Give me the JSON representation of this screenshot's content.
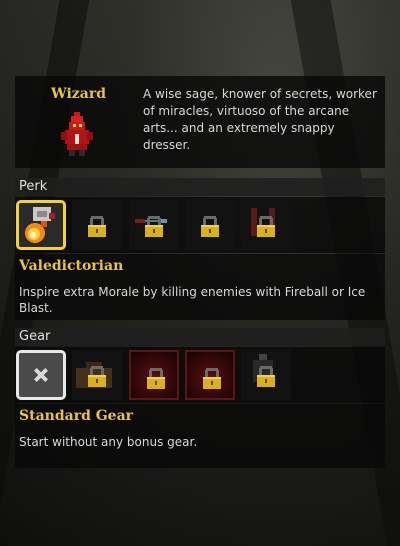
{
  "class": {
    "name": "Wizard",
    "description": "A wise sage, knower of secrets, worker of miracles, virtuoso of the arcane arts... and an extremely snappy dresser."
  },
  "perk": {
    "section_label": "Perk",
    "selected_name": "Valedictorian",
    "selected_description": "Inspire extra Morale by killing enemies with Fireball or Ice Blast.",
    "slots": [
      {
        "icon": "fireball-icon",
        "state": "selected"
      },
      {
        "icon": "lock-icon",
        "state": "locked"
      },
      {
        "icon": "lock-icon",
        "state": "locked"
      },
      {
        "icon": "lock-icon",
        "state": "locked"
      },
      {
        "icon": "lock-icon",
        "state": "locked"
      }
    ]
  },
  "gear": {
    "section_label": "Gear",
    "selected_name": "Standard Gear",
    "selected_description": "Start without any bonus gear.",
    "slots": [
      {
        "icon": "x-icon",
        "state": "selected"
      },
      {
        "icon": "lock-icon",
        "state": "locked"
      },
      {
        "icon": "lock-icon",
        "state": "locked"
      },
      {
        "icon": "lock-icon",
        "state": "locked"
      },
      {
        "icon": "lock-icon",
        "state": "locked"
      }
    ]
  },
  "colors": {
    "title_gold": "#e8c24a",
    "perk_selection": "#f2d23a",
    "gear_selection": "#e8e8e8",
    "slot_red": "#5a0f12"
  }
}
